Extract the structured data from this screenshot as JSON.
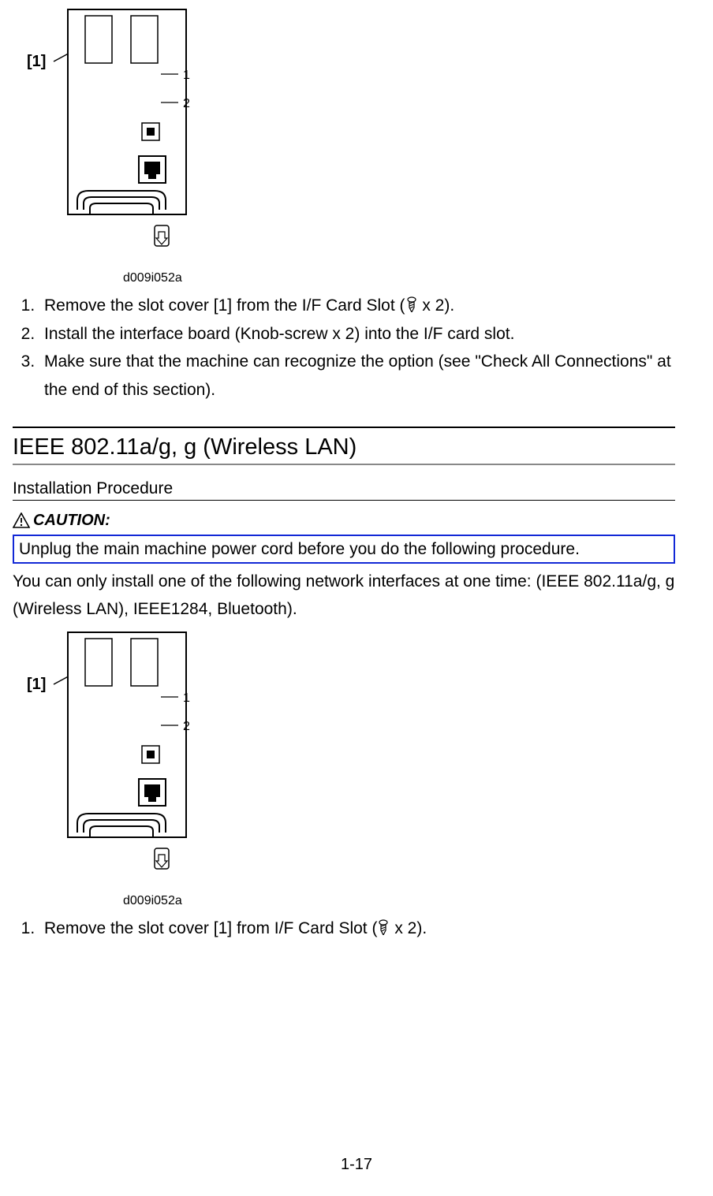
{
  "figure1": {
    "caption": "d009i052a",
    "callout": "[1]",
    "label1": "1",
    "label2": "2"
  },
  "steps1": [
    {
      "prefix": "Remove the slot cover [1] from the I/F Card Slot (",
      "suffix": " x 2)."
    },
    {
      "text": "Install the interface board (Knob-screw x 2) into the I/F card slot."
    },
    {
      "text": "Make sure that the machine can recognize the option (see \"Check All Connections\" at the end of this section)."
    }
  ],
  "section": {
    "title": "IEEE 802.11a/g, g (Wireless LAN)",
    "subtitle": "Installation Procedure"
  },
  "caution": {
    "label": "CAUTION:",
    "text": "Unplug the main machine power cord before you do the following procedure."
  },
  "body_note": "You can only install one of the following network interfaces at one time: (IEEE 802.11a/g, g (Wireless LAN), IEEE1284, Bluetooth).",
  "figure2": {
    "caption": "d009i052a",
    "callout": "[1]",
    "label1": "1",
    "label2": "2"
  },
  "steps2": [
    {
      "prefix": "Remove the slot cover [1] from I/F Card Slot (",
      "suffix": " x 2)."
    }
  ],
  "page_number": "1-17"
}
